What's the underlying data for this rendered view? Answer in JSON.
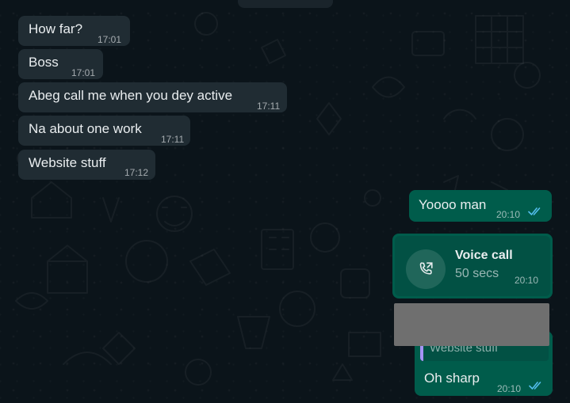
{
  "colors": {
    "chat_background": "#0b141a",
    "incoming_bubble": "#202c33",
    "outgoing_bubble": "#005c4b",
    "read_ticks": "#53bdeb",
    "quote_accent": "#a593f5"
  },
  "messages": [
    {
      "direction": "incoming",
      "text": "How far?",
      "time": "17:01"
    },
    {
      "direction": "incoming",
      "text": "Boss",
      "time": "17:01"
    },
    {
      "direction": "incoming",
      "text": "Abeg call me when you dey active",
      "time": "17:11"
    },
    {
      "direction": "incoming",
      "text": "Na about one work",
      "time": "17:11"
    },
    {
      "direction": "incoming",
      "text": "Website stuff",
      "time": "17:12"
    },
    {
      "direction": "outgoing",
      "text": "Yoooo man",
      "time": "20:10",
      "status_icon": "double-check-icon"
    },
    {
      "direction": "outgoing",
      "type": "voice_call",
      "title": "Voice call",
      "duration": "50 secs",
      "time": "20:10",
      "icon": "outgoing-call-icon"
    },
    {
      "direction": "outgoing",
      "quoted_text": "Website stuff",
      "text": "Oh sharp",
      "time": "20:10",
      "status_icon": "double-check-icon"
    }
  ]
}
